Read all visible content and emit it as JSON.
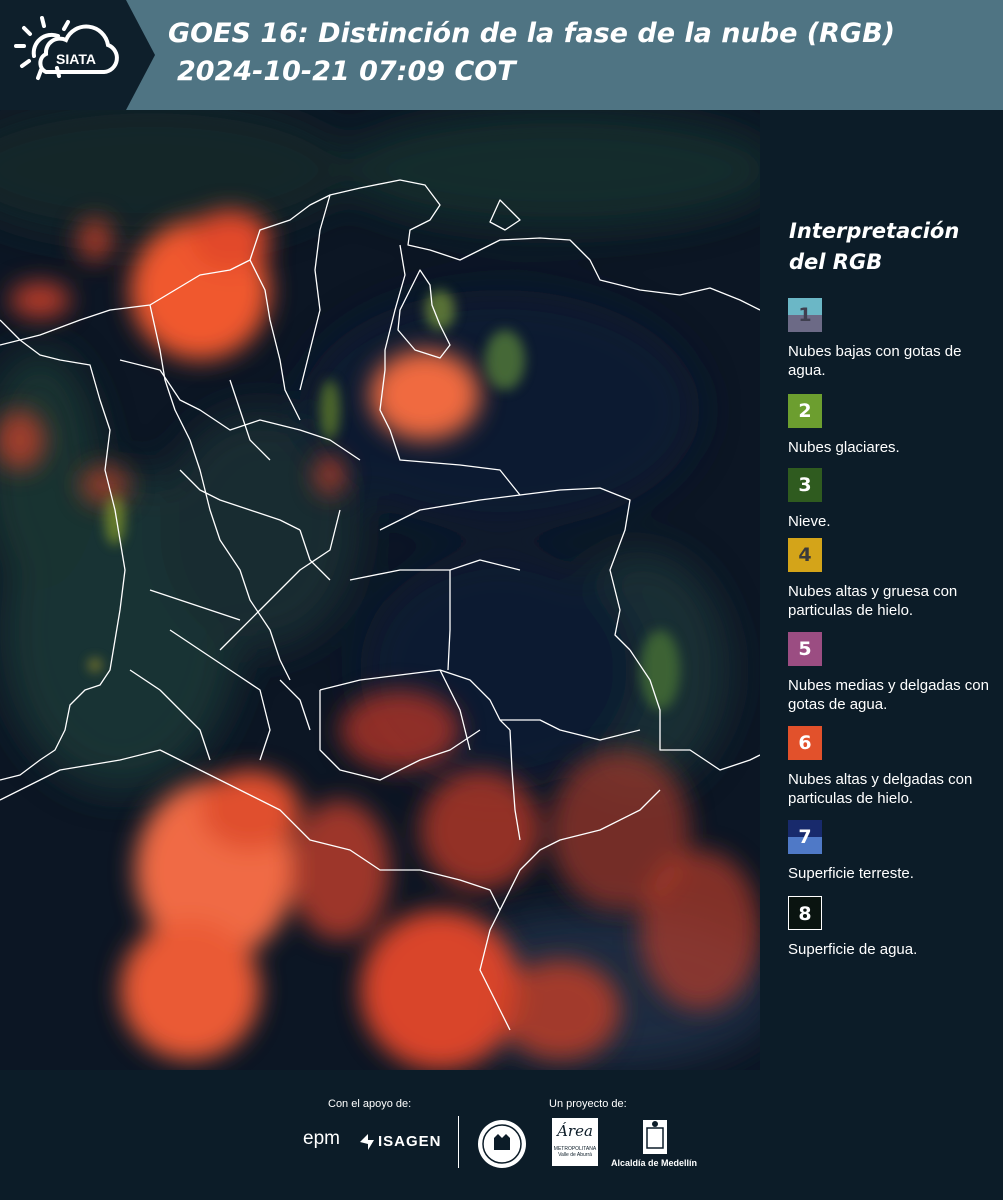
{
  "header": {
    "logo_text": "SIATA",
    "title": "GOES 16: Distinción de la fase de la nube (RGB)",
    "subtitle": "2024-10-21 07:09 COT"
  },
  "legend": {
    "title": "Interpretación del RGB",
    "items": [
      {
        "number": "1",
        "label": "Nubes bajas con gotas de agua.",
        "color_top": "#6bb7c6",
        "color_bottom": "#6c6a86",
        "text_color": "#3f3f4f"
      },
      {
        "number": "2",
        "label": "Nubes glaciares.",
        "color_top": "#6c9e2f",
        "color_bottom": "#6c9e2f",
        "text_color": "#ffffff"
      },
      {
        "number": "3",
        "label": "Nieve.",
        "color_top": "#2f5b1f",
        "color_bottom": "#2f5b1f",
        "text_color": "#ffffff"
      },
      {
        "number": "4",
        "label": "Nubes altas y gruesa con particulas de hielo.",
        "color_top": "#d4a419",
        "color_bottom": "#d4a419",
        "text_color": "#3a3a3a"
      },
      {
        "number": "5",
        "label": "Nubes medias y delgadas con gotas de agua.",
        "color_top": "#9b4d82",
        "color_bottom": "#9b4d82",
        "text_color": "#ffffff"
      },
      {
        "number": "6",
        "label": "Nubes altas y delgadas con particulas de hielo.",
        "color_top": "#e2512b",
        "color_bottom": "#e2512b",
        "text_color": "#ffffff"
      },
      {
        "number": "7",
        "label": "Superficie terreste.",
        "color_top": "#182a6c",
        "color_bottom": "#4f79c7",
        "text_color": "#ffffff"
      },
      {
        "number": "8",
        "label": "Superficie de agua.",
        "color_top": "#0a1410",
        "color_bottom": "#0a1410",
        "text_color": "#ffffff"
      }
    ]
  },
  "footer": {
    "support_label": "Con el apoyo de:",
    "project_label": "Un proyecto de:",
    "epm": "epm",
    "isagen": "ISAGEN",
    "area_text": "Área",
    "area_sub": "METROPOLITANA",
    "area_sub2": "Valle de Aburrá",
    "alcaldia": "Alcaldía de Medellín"
  }
}
